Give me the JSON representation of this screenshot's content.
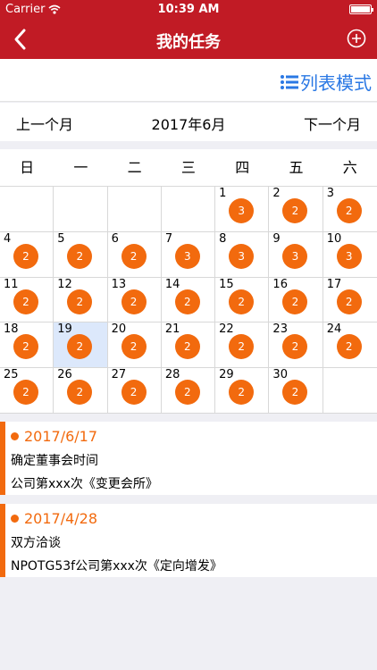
{
  "status": {
    "carrier": "Carrier",
    "time": "10:39 AM"
  },
  "nav": {
    "title": "我的任务"
  },
  "mode": {
    "label": "列表模式"
  },
  "month": {
    "prev": "上一个月",
    "current": "2017年6月",
    "next": "下一个月"
  },
  "weekdays": [
    "日",
    "一",
    "二",
    "三",
    "四",
    "五",
    "六"
  ],
  "calendar": {
    "selected_day": "19",
    "cells": [
      {
        "day": "",
        "count": ""
      },
      {
        "day": "",
        "count": ""
      },
      {
        "day": "",
        "count": ""
      },
      {
        "day": "",
        "count": ""
      },
      {
        "day": "1",
        "count": "3"
      },
      {
        "day": "2",
        "count": "2"
      },
      {
        "day": "3",
        "count": "2"
      },
      {
        "day": "4",
        "count": "2"
      },
      {
        "day": "5",
        "count": "2"
      },
      {
        "day": "6",
        "count": "2"
      },
      {
        "day": "7",
        "count": "3"
      },
      {
        "day": "8",
        "count": "3"
      },
      {
        "day": "9",
        "count": "3"
      },
      {
        "day": "10",
        "count": "3"
      },
      {
        "day": "11",
        "count": "2"
      },
      {
        "day": "12",
        "count": "2"
      },
      {
        "day": "13",
        "count": "2"
      },
      {
        "day": "14",
        "count": "2"
      },
      {
        "day": "15",
        "count": "2"
      },
      {
        "day": "16",
        "count": "2"
      },
      {
        "day": "17",
        "count": "2"
      },
      {
        "day": "18",
        "count": "2"
      },
      {
        "day": "19",
        "count": "2"
      },
      {
        "day": "20",
        "count": "2"
      },
      {
        "day": "21",
        "count": "2"
      },
      {
        "day": "22",
        "count": "2"
      },
      {
        "day": "23",
        "count": "2"
      },
      {
        "day": "24",
        "count": "2"
      },
      {
        "day": "25",
        "count": "2"
      },
      {
        "day": "26",
        "count": "2"
      },
      {
        "day": "27",
        "count": "2"
      },
      {
        "day": "28",
        "count": "2"
      },
      {
        "day": "29",
        "count": "2"
      },
      {
        "day": "30",
        "count": "2"
      },
      {
        "day": "",
        "count": ""
      }
    ]
  },
  "tasks": [
    {
      "date": "2017/6/17",
      "title": "确定董事会时间",
      "detail": "公司第xxx次《变更会所》"
    },
    {
      "date": "2017/4/28",
      "title": "双方洽谈",
      "detail": "NPOTG53f公司第xxx次《定向增发》"
    }
  ],
  "colors": {
    "brand": "#c11b25",
    "accent": "#f26a0e",
    "link": "#2a78e4",
    "selected": "#dce8fb"
  }
}
